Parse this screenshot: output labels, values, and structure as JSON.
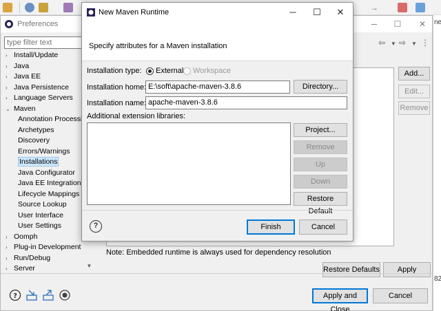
{
  "preferences": {
    "title": "Preferences",
    "filter_placeholder": "type filter text",
    "tree": [
      {
        "label": "Install/Update",
        "arrow": "›",
        "level": 0
      },
      {
        "label": "Java",
        "arrow": "›",
        "level": 0
      },
      {
        "label": "Java EE",
        "arrow": "›",
        "level": 0
      },
      {
        "label": "Java Persistence",
        "arrow": "›",
        "level": 0
      },
      {
        "label": "Language Servers",
        "arrow": "›",
        "level": 0
      },
      {
        "label": "Maven",
        "arrow": "⌄",
        "level": 0
      },
      {
        "label": "Annotation Processing",
        "arrow": "",
        "level": 1
      },
      {
        "label": "Archetypes",
        "arrow": "",
        "level": 1
      },
      {
        "label": "Discovery",
        "arrow": "",
        "level": 1
      },
      {
        "label": "Errors/Warnings",
        "arrow": "",
        "level": 1
      },
      {
        "label": "Installations",
        "arrow": "",
        "level": 1,
        "selected": true
      },
      {
        "label": "Java Configurator",
        "arrow": "",
        "level": 1
      },
      {
        "label": "Java EE Integration",
        "arrow": "",
        "level": 1
      },
      {
        "label": "Lifecycle Mappings",
        "arrow": "",
        "level": 1
      },
      {
        "label": "Source Lookup",
        "arrow": "",
        "level": 1
      },
      {
        "label": "User Interface",
        "arrow": "",
        "level": 1
      },
      {
        "label": "User Settings",
        "arrow": "",
        "level": 1
      },
      {
        "label": "Oomph",
        "arrow": "›",
        "level": 0
      },
      {
        "label": "Plug-in Development",
        "arrow": "›",
        "level": 0
      },
      {
        "label": "Run/Debug",
        "arrow": "›",
        "level": 0
      },
      {
        "label": "Server",
        "arrow": "›",
        "level": 0
      }
    ],
    "side_buttons": {
      "add": "Add...",
      "edit": "Edit...",
      "remove": "Remove"
    },
    "note": "Note: Embedded runtime is always used for dependency resolution",
    "restore_defaults": "Restore Defaults",
    "apply": "Apply",
    "apply_and_close": "Apply and Close",
    "cancel": "Cancel"
  },
  "dialog": {
    "title": "New Maven Runtime",
    "banner": "Specify attributes for a Maven installation",
    "installation_type_label": "Installation type:",
    "type_external": "External",
    "type_workspace": "Workspace",
    "installation_home_label": "Installation home:",
    "installation_home_value": "E:\\soft\\apache-maven-3.8.6",
    "directory_button": "Directory...",
    "installation_name_label": "Installation name:",
    "installation_name_value": "apache-maven-3.8.6",
    "extension_libraries_label": "Additional extension libraries:",
    "buttons": {
      "project": "Project...",
      "remove": "Remove",
      "up": "Up",
      "down": "Down",
      "restore_default": "Restore Default"
    },
    "help": "?",
    "finish": "Finish",
    "cancel": "Cancel"
  },
  "edge_text": {
    "top": "ne",
    "bottom": "82"
  }
}
